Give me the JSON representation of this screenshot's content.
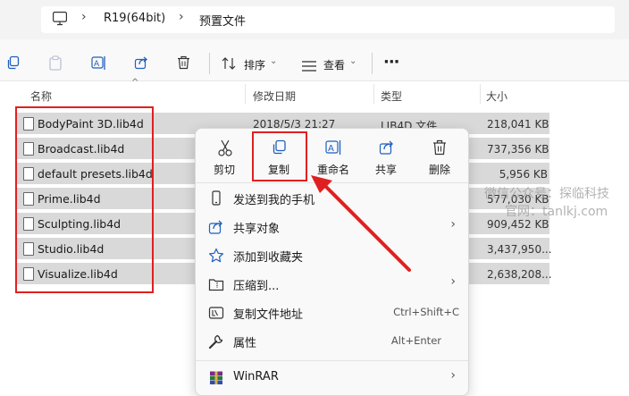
{
  "address": {
    "crumbs": [
      "R19(64bit)",
      "预置文件"
    ]
  },
  "toolbar": {
    "sort_label": "排序",
    "view_label": "查看",
    "more_label": "···"
  },
  "columns": {
    "name": "名称",
    "modified": "修改日期",
    "type": "类型",
    "size": "大小"
  },
  "files": [
    {
      "name": "BodyPaint 3D.lib4d",
      "modified": "2018/5/3 21:27",
      "type": "LIB4D 文件",
      "size": "218,041 KB"
    },
    {
      "name": "Broadcast.lib4d",
      "size": "737,356 KB"
    },
    {
      "name": "default presets.lib4d",
      "size": "5,956 KB"
    },
    {
      "name": "Prime.lib4d",
      "size": "577,030 KB"
    },
    {
      "name": "Sculpting.lib4d",
      "size": "909,452 KB"
    },
    {
      "name": "Studio.lib4d",
      "size": "3,437,950..."
    },
    {
      "name": "Visualize.lib4d",
      "size": "2,638,208..."
    }
  ],
  "context_menu": {
    "quick_actions": [
      {
        "label": "剪切",
        "icon": "scissors-icon"
      },
      {
        "label": "复制",
        "icon": "copy-icon"
      },
      {
        "label": "重命名",
        "icon": "rename-icon"
      },
      {
        "label": "共享",
        "icon": "share-icon"
      },
      {
        "label": "删除",
        "icon": "trash-icon"
      }
    ],
    "items": [
      {
        "label": "发送到我的手机",
        "icon": "phone-icon"
      },
      {
        "label": "共享对象",
        "icon": "share-icon",
        "submenu": true
      },
      {
        "label": "添加到收藏夹",
        "icon": "star-icon"
      },
      {
        "label": "压缩到...",
        "icon": "zip-icon",
        "submenu": true
      },
      {
        "label": "复制文件地址",
        "icon": "path-icon",
        "shortcut": "Ctrl+Shift+C"
      },
      {
        "label": "属性",
        "icon": "wrench-icon",
        "shortcut": "Alt+Enter"
      },
      {
        "label": "WinRAR",
        "icon": "winrar-icon",
        "submenu": true
      }
    ]
  },
  "watermark": {
    "line1": "微信公众号：探临科技",
    "line2": "官网：tanlkj.com"
  },
  "colors": {
    "highlight_red": "#e02020",
    "selected_row": "#d9d9d9",
    "accent_blue": "#1f5fbf"
  }
}
